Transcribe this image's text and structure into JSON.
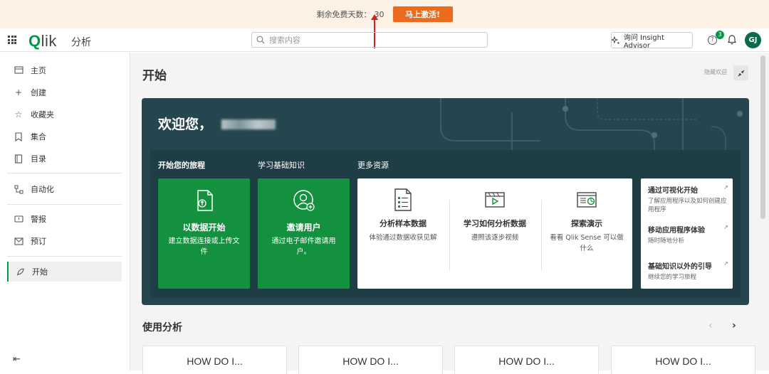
{
  "trial": {
    "label": "剩余免费天数：",
    "days": "30",
    "activate_label": "马上激活!"
  },
  "topnav": {
    "logo": "Qlik",
    "app_label": "分析",
    "search_placeholder": "搜索内容",
    "insight_label": "询问 Insight Advisor",
    "help_badge": "3",
    "avatar_initials": "GJ"
  },
  "sidebar": {
    "items": [
      {
        "label": "主页",
        "icon": "home-icon"
      },
      {
        "label": "创建",
        "icon": "plus-icon"
      },
      {
        "label": "收藏夹",
        "icon": "star-icon"
      },
      {
        "label": "集合",
        "icon": "bookmark-icon"
      },
      {
        "label": "目录",
        "icon": "catalog-icon"
      },
      {
        "label": "自动化",
        "icon": "automation-icon"
      },
      {
        "label": "警报",
        "icon": "alert-icon"
      },
      {
        "label": "预订",
        "icon": "mail-icon"
      },
      {
        "label": "开始",
        "icon": "rocket-icon"
      }
    ]
  },
  "main": {
    "title": "开始",
    "hide_welcome": "隐藏欢迎",
    "hero": {
      "title": "欢迎您，",
      "tabs": [
        "开始您的旅程",
        "学习基础知识",
        "更多资源"
      ],
      "green_cards": [
        {
          "title": "以数据开始",
          "desc": "建立数据连接或上传文件"
        },
        {
          "title": "邀请用户",
          "desc": "通过电子邮件邀请用户。"
        }
      ],
      "resources": [
        {
          "title": "分析样本数据",
          "desc": "体验通过数据收获见解"
        },
        {
          "title": "学习如何分析数据",
          "desc": "遵照该逐步视频"
        },
        {
          "title": "探索演示",
          "desc": "看看 Qlik Sense 可以做什么"
        }
      ],
      "links": [
        {
          "title": "通过可视化开始",
          "desc": "了解应用程序以及如何创建应用程序"
        },
        {
          "title": "移动应用程序体验",
          "desc": "随时随地分析"
        },
        {
          "title": "基础知识以外的引导",
          "desc": "继续您的学习旅程"
        }
      ]
    },
    "section_title": "使用分析",
    "how_cards": [
      "HOW DO I...",
      "HOW DO I...",
      "HOW DO I...",
      "HOW DO I..."
    ]
  },
  "colors": {
    "brand_green": "#009845",
    "card_green": "#14913f",
    "hero_bg": "#26464f",
    "activate_orange": "#ea6a1e"
  }
}
